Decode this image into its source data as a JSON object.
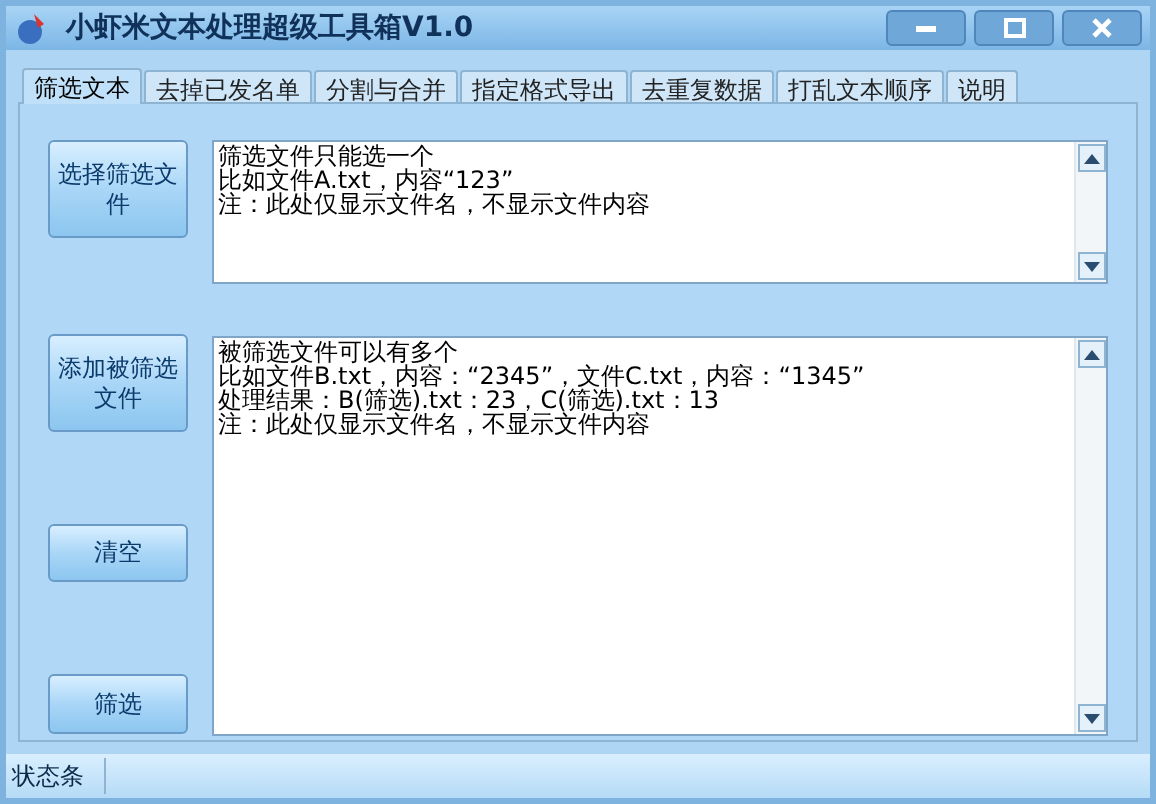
{
  "window": {
    "title": "小虾米文本处理超级工具箱V1.0"
  },
  "tabs": [
    {
      "label": "筛选文本",
      "selected": true
    },
    {
      "label": "去掉已发名单",
      "selected": false
    },
    {
      "label": "分割与合并",
      "selected": false
    },
    {
      "label": "指定格式导出",
      "selected": false
    },
    {
      "label": "去重复数据",
      "selected": false
    },
    {
      "label": "打乱文本顺序",
      "selected": false
    },
    {
      "label": "说明",
      "selected": false
    }
  ],
  "buttons": [
    "选择筛选文件",
    "添加被筛选文件",
    "清空",
    "筛选"
  ],
  "filter_file_box": {
    "lines": [
      "筛选文件只能选一个",
      "比如文件A.txt，内容“123”",
      "注：此处仅显示文件名，不显示文件内容"
    ]
  },
  "target_files_box": {
    "lines": [
      "被筛选文件可以有多个",
      "比如文件B.txt，内容：“2345”，文件C.txt，内容：“1345”",
      "处理结果：B(筛选).txt：23，C(筛选).txt：13",
      "注：此处仅显示文件名，不显示文件内容"
    ]
  },
  "status_bar": {
    "text": "状态条"
  }
}
